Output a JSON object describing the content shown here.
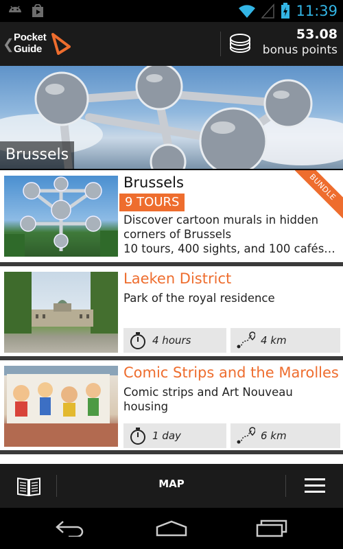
{
  "status_bar": {
    "time": "11:39",
    "icons": [
      "android-icon",
      "play-store-icon",
      "wifi-icon",
      "signal-icon",
      "battery-charging-icon"
    ]
  },
  "header": {
    "logo_line1": "Pocket",
    "logo_line2": "Guide",
    "points_value": "53.08",
    "points_label": "bonus points"
  },
  "hero": {
    "title": "Brussels"
  },
  "cards": [
    {
      "title": "Brussels",
      "badge": "9 TOURS",
      "ribbon": "BUNDLE",
      "desc_line1": "Discover cartoon murals in hidden",
      "desc_line2": "corners of Brussels",
      "desc_line3": "10 tours, 400 sights, and 100 cafés…"
    },
    {
      "title": "Laeken District",
      "desc_line1": "Park of the royal residence",
      "duration": "4 hours",
      "distance": "4 km"
    },
    {
      "title": "Comic Strips and the Marolles",
      "desc_line1": "Comic strips and Art Nouveau",
      "desc_line2": "housing",
      "duration": "1 day",
      "distance": "6 km"
    }
  ],
  "bottom_bar": {
    "map_label": "MAP"
  },
  "colors": {
    "accent": "#ee6d2e",
    "status_blue": "#33b5e5",
    "bar_bg": "#1b1b1b"
  }
}
